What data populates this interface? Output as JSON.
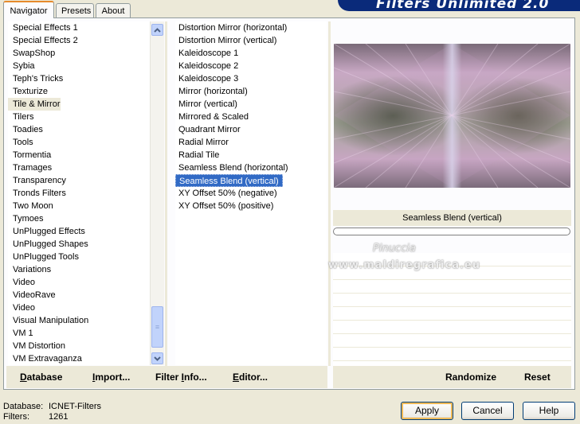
{
  "brand": {
    "title": "Filters Unlimited 2.0"
  },
  "tabs": [
    {
      "label": "Navigator",
      "active": true
    },
    {
      "label": "Presets",
      "active": false
    },
    {
      "label": "About",
      "active": false
    }
  ],
  "categories": [
    "Special Effects 1",
    "Special Effects 2",
    "SwapShop",
    "Sybia",
    "Teph's Tricks",
    "Texturize",
    "Tile & Mirror",
    "Tilers",
    "Toadies",
    "Tools",
    "Tormentia",
    "Tramages",
    "Transparency",
    "Tronds Filters",
    "Two Moon",
    "Tymoes",
    "UnPlugged Effects",
    "UnPlugged Shapes",
    "UnPlugged Tools",
    "Variations",
    "Video",
    "VideoRave",
    "Video",
    "Visual Manipulation",
    "VM 1",
    "VM Distortion",
    "VM Extravaganza"
  ],
  "selected_category": "Tile & Mirror",
  "filters": [
    "Distortion Mirror (horizontal)",
    "Distortion Mirror (vertical)",
    "Kaleidoscope 1",
    "Kaleidoscope 2",
    "Kaleidoscope 3",
    "Mirror (horizontal)",
    "Mirror (vertical)",
    "Mirrored & Scaled",
    "Quadrant Mirror",
    "Radial Mirror",
    "Radial Tile",
    "Seamless Blend (horizontal)",
    "Seamless Blend (vertical)",
    "XY Offset 50% (negative)",
    "XY Offset 50% (positive)"
  ],
  "selected_filter": "Seamless Blend (vertical)",
  "preview": {
    "filter_name": "Seamless Blend (vertical)",
    "progress": 0
  },
  "left_buttons": {
    "database": {
      "first": "D",
      "rest": "atabase"
    },
    "import": {
      "first": "I",
      "rest": "mport..."
    },
    "filter_info": {
      "pre": "Filter ",
      "first": "I",
      "rest": "nfo..."
    },
    "editor": {
      "first": "E",
      "rest": "ditor..."
    }
  },
  "right_buttons": {
    "randomize": "Randomize",
    "reset": "Reset"
  },
  "status": {
    "database_label": "Database:",
    "database_value": "ICNET-Filters",
    "filters_label": "Filters:",
    "filters_value": "1261"
  },
  "dialog_buttons": {
    "apply": "Apply",
    "cancel": "Cancel",
    "help": "Help"
  },
  "watermark": {
    "line1": "Pinuccia",
    "line2": "www.maldiregrafica.eu"
  },
  "colors": {
    "selection": "#316ac5",
    "banner": "#0a2a7a",
    "face": "#ece9d8"
  }
}
